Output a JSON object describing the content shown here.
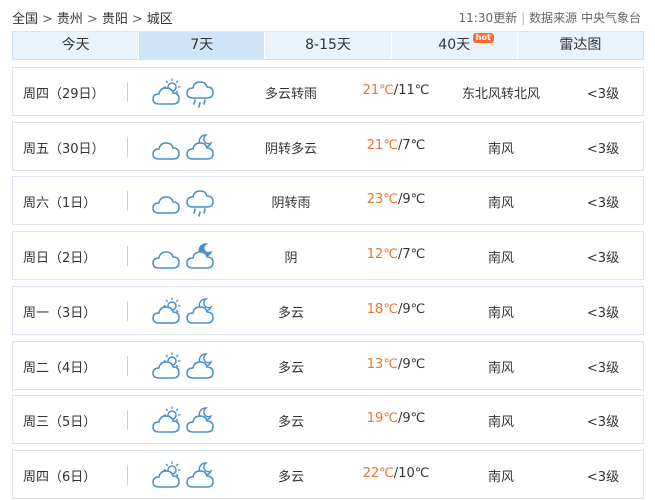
{
  "breadcrumb": {
    "items": [
      "全国",
      "贵州",
      "贵阳",
      "城区"
    ],
    "separator": ">"
  },
  "meta": {
    "update_time": "11:30更新",
    "source": "数据来源 中央气象台"
  },
  "tabs": [
    {
      "label": "今天",
      "active": false
    },
    {
      "label": "7天",
      "active": true
    },
    {
      "label": "8-15天",
      "active": false
    },
    {
      "label": "40天",
      "active": false,
      "badge": "hot"
    },
    {
      "label": "雷达图",
      "active": false
    }
  ],
  "colors": {
    "accent": "#e8752b",
    "tab_bg": "#e9f3fb",
    "tab_active_bg": "#cfe5f7",
    "icon_blue": "#4a90c8",
    "hot_badge": "#ff6b2c"
  },
  "forecast": [
    {
      "date": "周四（29日）",
      "day_icon": "partly-cloudy-day-icon",
      "night_icon": "rain-icon",
      "desc": "多云转雨",
      "high": "21℃",
      "low": "11℃",
      "wind": "东北风转北风",
      "level": "<3级"
    },
    {
      "date": "周五（30日）",
      "day_icon": "cloudy-icon",
      "night_icon": "partly-cloudy-night-icon",
      "desc": "阴转多云",
      "high": "21℃",
      "low": "7℃",
      "wind": "南风",
      "level": "<3级"
    },
    {
      "date": "周六（1日）",
      "day_icon": "cloudy-icon",
      "night_icon": "rain-icon",
      "desc": "阴转雨",
      "high": "23℃",
      "low": "9℃",
      "wind": "南风",
      "level": "<3级"
    },
    {
      "date": "周日（2日）",
      "day_icon": "cloudy-icon",
      "night_icon": "cloudy-night-icon",
      "desc": "阴",
      "high": "12℃",
      "low": "7℃",
      "wind": "南风",
      "level": "<3级"
    },
    {
      "date": "周一（3日）",
      "day_icon": "partly-cloudy-day-icon",
      "night_icon": "partly-cloudy-night-icon",
      "desc": "多云",
      "high": "18℃",
      "low": "9℃",
      "wind": "南风",
      "level": "<3级"
    },
    {
      "date": "周二（4日）",
      "day_icon": "partly-cloudy-day-icon",
      "night_icon": "partly-cloudy-night-icon",
      "desc": "多云",
      "high": "13℃",
      "low": "9℃",
      "wind": "南风",
      "level": "<3级"
    },
    {
      "date": "周三（5日）",
      "day_icon": "partly-cloudy-day-icon",
      "night_icon": "partly-cloudy-night-icon",
      "desc": "多云",
      "high": "19℃",
      "low": "9℃",
      "wind": "南风",
      "level": "<3级"
    },
    {
      "date": "周四（6日）",
      "day_icon": "partly-cloudy-day-icon",
      "night_icon": "partly-cloudy-night-icon",
      "desc": "多云",
      "high": "22℃",
      "low": "10℃",
      "wind": "南风",
      "level": "<3级"
    }
  ]
}
